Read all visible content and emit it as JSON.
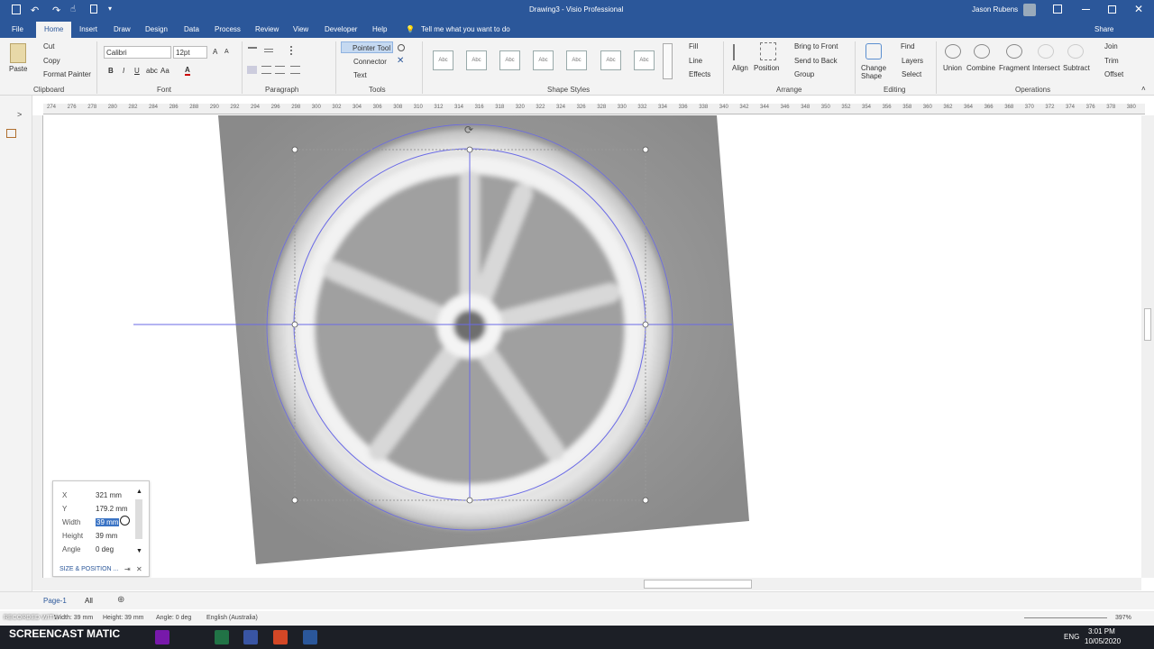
{
  "titlebar": {
    "doc_title": "Drawing3  -  Visio Professional",
    "user_name": "Jason Rubens"
  },
  "tabs": [
    {
      "label": "File"
    },
    {
      "label": "Home"
    },
    {
      "label": "Insert"
    },
    {
      "label": "Draw"
    },
    {
      "label": "Design"
    },
    {
      "label": "Data"
    },
    {
      "label": "Process"
    },
    {
      "label": "Review"
    },
    {
      "label": "View"
    },
    {
      "label": "Developer"
    },
    {
      "label": "Help"
    }
  ],
  "tell_me": "Tell me what you want to do",
  "share": "Share",
  "clipboard": {
    "paste": "Paste",
    "cut": "Cut",
    "copy": "Copy",
    "format_painter": "Format Painter",
    "group": "Clipboard"
  },
  "font": {
    "name": "Calibri",
    "size": "12pt",
    "group": "Font"
  },
  "paragraph": {
    "group": "Paragraph"
  },
  "tools": {
    "pointer": "Pointer Tool",
    "connector": "Connector",
    "text": "Text",
    "group": "Tools"
  },
  "shape_styles": {
    "sample": "Abc",
    "group": "Shape Styles"
  },
  "shape_format": {
    "fill": "Fill",
    "line": "Line",
    "effects": "Effects"
  },
  "arrange": {
    "align": "Align",
    "position": "Position",
    "bring_front": "Bring to Front",
    "send_back": "Send to Back",
    "group_btn": "Group",
    "group": "Arrange"
  },
  "editing": {
    "change_shape": "Change Shape",
    "find": "Find",
    "layers": "Layers",
    "select": "Select",
    "group": "Editing"
  },
  "operations": {
    "union": "Union",
    "combine": "Combine",
    "fragment": "Fragment",
    "intersect": "Intersect",
    "subtract": "Subtract",
    "join": "Join",
    "trim": "Trim",
    "offset": "Offset",
    "group": "Operations"
  },
  "ruler_ticks": [
    "274",
    "276",
    "278",
    "280",
    "282",
    "284",
    "286",
    "288",
    "290",
    "292",
    "294",
    "296",
    "298",
    "300",
    "302",
    "304",
    "306",
    "308",
    "310",
    "312",
    "314",
    "316",
    "318",
    "320",
    "322",
    "324",
    "326",
    "328",
    "330",
    "332",
    "334",
    "336",
    "338",
    "340",
    "342",
    "344",
    "346",
    "348",
    "350",
    "352",
    "354",
    "356",
    "358",
    "360",
    "362",
    "364",
    "366",
    "368",
    "370",
    "372",
    "374",
    "376",
    "378",
    "380"
  ],
  "size_position": {
    "x_label": "X",
    "x_value": "321 mm",
    "y_label": "Y",
    "y_value": "179.2 mm",
    "width_label": "Width",
    "width_value": "39 mm",
    "height_label": "Height",
    "height_value": "39 mm",
    "angle_label": "Angle",
    "angle_value": "0 deg",
    "title": "SIZE & POSITION ..."
  },
  "page_tabs": {
    "page1": "Page-1",
    "all": "All"
  },
  "status": {
    "width": "Width: 39 mm",
    "height": "Height: 39 mm",
    "angle": "Angle: 0 deg",
    "language": "English (Australia)",
    "zoom": "397%"
  },
  "taskbar": {
    "screencast": "SCREENCAST MATIC",
    "recorded": "RECORDED WITH",
    "lang": "ENG",
    "time": "3:01 PM",
    "date": "10/05/2020"
  },
  "colors": {
    "accent": "#2b579a",
    "selection": "#6a6ae6"
  }
}
